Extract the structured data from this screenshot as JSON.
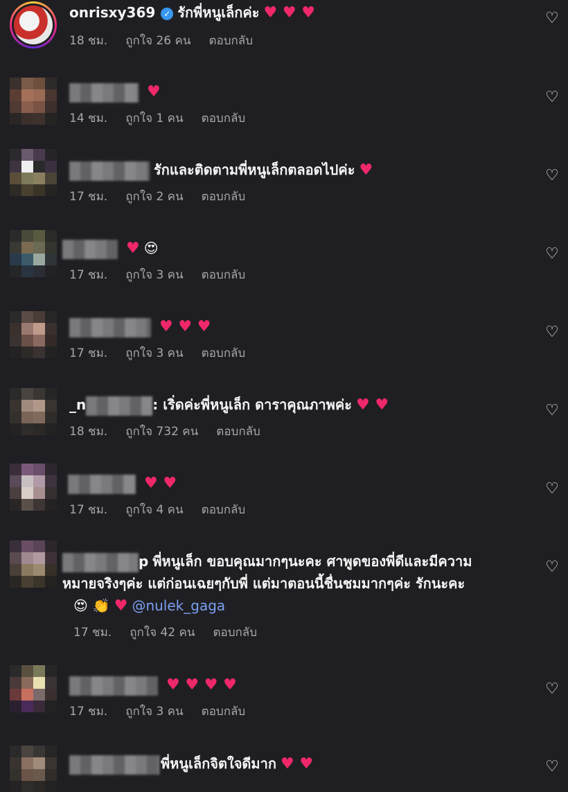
{
  "comments": [
    {
      "username": "onrisxy369",
      "verified": true,
      "text": "รักพี่หนูเล็กค่ะ",
      "hearts": "♥ ♥ ♥",
      "time": "18 ชม.",
      "likes": "ถูกใจ 26 คน",
      "reply": "ตอบกลับ"
    },
    {
      "username": "",
      "text": "",
      "hearts": "♥",
      "time": "14 ชม.",
      "likes": "ถูกใจ 1 คน",
      "reply": "ตอบกลับ"
    },
    {
      "username": "",
      "text": "รักและติดตามพี่หนูเล็กตลอดไปค่ะ",
      "hearts": "♥",
      "time": "17 ชม.",
      "likes": "ถูกใจ 2 คน",
      "reply": "ตอบกลับ"
    },
    {
      "username": "",
      "text": "",
      "hearts": "♥",
      "emoji": "😍",
      "time": "17 ชม.",
      "likes": "ถูกใจ 3 คน",
      "reply": "ตอบกลับ"
    },
    {
      "username": "",
      "text": "",
      "hearts": "♥ ♥ ♥",
      "time": "17 ชม.",
      "likes": "ถูกใจ 3 คน",
      "reply": "ตอบกลับ"
    },
    {
      "username": "_n",
      "text": ": เริ่ดค่ะพี่หนูเล็ก ดาราคุณภาพค่ะ",
      "hearts": "♥ ♥",
      "time": "18 ชม.",
      "likes": "ถูกใจ 732 คน",
      "reply": "ตอบกลับ"
    },
    {
      "username": "",
      "text": "",
      "hearts": "♥ ♥",
      "time": "17 ชม.",
      "likes": "ถูกใจ 4 คน",
      "reply": "ตอบกลับ"
    },
    {
      "username": "p",
      "line1": "พี่หนูเล็ก ขอบคุณมากๆนะคะ ศาพูดของพี่ดีและมีความ",
      "line2": "หมายจริงๆค่ะ แต่ก่อนเฉยๆกับพี่ แต่มาตอนนี้ชื่นชมมากๆค่ะ รักนะคะ",
      "emoji": "😍 👏",
      "hearts": "♥",
      "mention": "@nulek_gaga",
      "time": "17 ชม.",
      "likes": "ถูกใจ 42 คน",
      "reply": "ตอบกลับ"
    },
    {
      "username": "",
      "text": "",
      "hearts": "♥ ♥ ♥ ♥",
      "time": "17 ชม.",
      "likes": "ถูกใจ 3 คน",
      "reply": "ตอบกลับ"
    },
    {
      "username": "",
      "text": "พี่หนูเล็กจิตใจดีมาก",
      "hearts": "♥ ♥"
    }
  ],
  "icons": {
    "like": "heart-outline-icon",
    "verified": "verified-badge-icon"
  },
  "colors": {
    "background": "#1f1f23",
    "heart": "#f0286a",
    "mention": "#7b9ff0",
    "meta": "#a8a8a8"
  }
}
